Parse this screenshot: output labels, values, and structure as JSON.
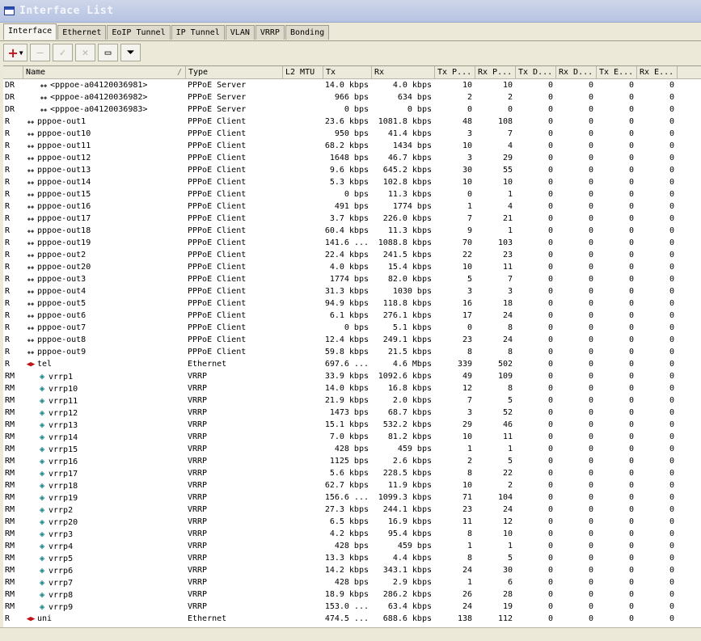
{
  "window": {
    "title": "Interface List"
  },
  "tabs": [
    "Interface",
    "Ethernet",
    "EoIP Tunnel",
    "IP Tunnel",
    "VLAN",
    "VRRP",
    "Bonding"
  ],
  "toolbar": {
    "add": "add-icon",
    "remove": "minus-icon",
    "enable": "check-icon",
    "disable": "cross-icon",
    "comment": "comment-icon",
    "filter": "filter-icon"
  },
  "columns": [
    "",
    "Name",
    "Type",
    "L2 MTU",
    "Tx",
    "Rx",
    "Tx P...",
    "Rx P...",
    "Tx D...",
    "Rx D...",
    "Tx E...",
    "Rx E..."
  ],
  "rows": [
    [
      "DR",
      "<pppoe-a04120036981>",
      "PPPoE Server",
      "",
      "14.0 kbps",
      "4.0 kbps",
      "10",
      "10",
      "0",
      "0",
      "0",
      "0"
    ],
    [
      "DR",
      "<pppoe-a04120036982>",
      "PPPoE Server",
      "",
      "966 bps",
      "634 bps",
      "2",
      "2",
      "0",
      "0",
      "0",
      "0"
    ],
    [
      "DR",
      "<pppoe-a04120036983>",
      "PPPoE Server",
      "",
      "0 bps",
      "0 bps",
      "0",
      "0",
      "0",
      "0",
      "0",
      "0"
    ],
    [
      "R",
      "pppoe-out1",
      "PPPoE Client",
      "",
      "23.6 kbps",
      "1081.8 kbps",
      "48",
      "108",
      "0",
      "0",
      "0",
      "0"
    ],
    [
      "R",
      "pppoe-out10",
      "PPPoE Client",
      "",
      "950 bps",
      "41.4 kbps",
      "3",
      "7",
      "0",
      "0",
      "0",
      "0"
    ],
    [
      "R",
      "pppoe-out11",
      "PPPoE Client",
      "",
      "68.2 kbps",
      "1434 bps",
      "10",
      "4",
      "0",
      "0",
      "0",
      "0"
    ],
    [
      "R",
      "pppoe-out12",
      "PPPoE Client",
      "",
      "1648 bps",
      "46.7 kbps",
      "3",
      "29",
      "0",
      "0",
      "0",
      "0"
    ],
    [
      "R",
      "pppoe-out13",
      "PPPoE Client",
      "",
      "9.6 kbps",
      "645.2 kbps",
      "30",
      "55",
      "0",
      "0",
      "0",
      "0"
    ],
    [
      "R",
      "pppoe-out14",
      "PPPoE Client",
      "",
      "5.3 kbps",
      "102.8 kbps",
      "10",
      "10",
      "0",
      "0",
      "0",
      "0"
    ],
    [
      "R",
      "pppoe-out15",
      "PPPoE Client",
      "",
      "0 bps",
      "11.3 kbps",
      "0",
      "1",
      "0",
      "0",
      "0",
      "0"
    ],
    [
      "R",
      "pppoe-out16",
      "PPPoE Client",
      "",
      "491 bps",
      "1774 bps",
      "1",
      "4",
      "0",
      "0",
      "0",
      "0"
    ],
    [
      "R",
      "pppoe-out17",
      "PPPoE Client",
      "",
      "3.7 kbps",
      "226.0 kbps",
      "7",
      "21",
      "0",
      "0",
      "0",
      "0"
    ],
    [
      "R",
      "pppoe-out18",
      "PPPoE Client",
      "",
      "60.4 kbps",
      "11.3 kbps",
      "9",
      "1",
      "0",
      "0",
      "0",
      "0"
    ],
    [
      "R",
      "pppoe-out19",
      "PPPoE Client",
      "",
      "141.6 ...",
      "1088.8 kbps",
      "70",
      "103",
      "0",
      "0",
      "0",
      "0"
    ],
    [
      "R",
      "pppoe-out2",
      "PPPoE Client",
      "",
      "22.4 kbps",
      "241.5 kbps",
      "22",
      "23",
      "0",
      "0",
      "0",
      "0"
    ],
    [
      "R",
      "pppoe-out20",
      "PPPoE Client",
      "",
      "4.0 kbps",
      "15.4 kbps",
      "10",
      "11",
      "0",
      "0",
      "0",
      "0"
    ],
    [
      "R",
      "pppoe-out3",
      "PPPoE Client",
      "",
      "1774 bps",
      "82.0 kbps",
      "5",
      "7",
      "0",
      "0",
      "0",
      "0"
    ],
    [
      "R",
      "pppoe-out4",
      "PPPoE Client",
      "",
      "31.3 kbps",
      "1030 bps",
      "3",
      "3",
      "0",
      "0",
      "0",
      "0"
    ],
    [
      "R",
      "pppoe-out5",
      "PPPoE Client",
      "",
      "94.9 kbps",
      "118.8 kbps",
      "16",
      "18",
      "0",
      "0",
      "0",
      "0"
    ],
    [
      "R",
      "pppoe-out6",
      "PPPoE Client",
      "",
      "6.1 kbps",
      "276.1 kbps",
      "17",
      "24",
      "0",
      "0",
      "0",
      "0"
    ],
    [
      "R",
      "pppoe-out7",
      "PPPoE Client",
      "",
      "0 bps",
      "5.1 kbps",
      "0",
      "8",
      "0",
      "0",
      "0",
      "0"
    ],
    [
      "R",
      "pppoe-out8",
      "PPPoE Client",
      "",
      "12.4 kbps",
      "249.1 kbps",
      "23",
      "24",
      "0",
      "0",
      "0",
      "0"
    ],
    [
      "R",
      "pppoe-out9",
      "PPPoE Client",
      "",
      "59.8 kbps",
      "21.5 kbps",
      "8",
      "8",
      "0",
      "0",
      "0",
      "0"
    ],
    [
      "R",
      "tel",
      "Ethernet",
      "",
      "697.6 ...",
      "4.6 Mbps",
      "339",
      "502",
      "0",
      "0",
      "0",
      "0"
    ],
    [
      "RM",
      "vrrp1",
      "VRRP",
      "",
      "33.9 kbps",
      "1092.6 kbps",
      "49",
      "109",
      "0",
      "0",
      "0",
      "0"
    ],
    [
      "RM",
      "vrrp10",
      "VRRP",
      "",
      "14.0 kbps",
      "16.8 kbps",
      "12",
      "8",
      "0",
      "0",
      "0",
      "0"
    ],
    [
      "RM",
      "vrrp11",
      "VRRP",
      "",
      "21.9 kbps",
      "2.0 kbps",
      "7",
      "5",
      "0",
      "0",
      "0",
      "0"
    ],
    [
      "RM",
      "vrrp12",
      "VRRP",
      "",
      "1473 bps",
      "68.7 kbps",
      "3",
      "52",
      "0",
      "0",
      "0",
      "0"
    ],
    [
      "RM",
      "vrrp13",
      "VRRP",
      "",
      "15.1 kbps",
      "532.2 kbps",
      "29",
      "46",
      "0",
      "0",
      "0",
      "0"
    ],
    [
      "RM",
      "vrrp14",
      "VRRP",
      "",
      "7.0 kbps",
      "81.2 kbps",
      "10",
      "11",
      "0",
      "0",
      "0",
      "0"
    ],
    [
      "RM",
      "vrrp15",
      "VRRP",
      "",
      "428 bps",
      "459 bps",
      "1",
      "1",
      "0",
      "0",
      "0",
      "0"
    ],
    [
      "RM",
      "vrrp16",
      "VRRP",
      "",
      "1125 bps",
      "2.6 kbps",
      "2",
      "5",
      "0",
      "0",
      "0",
      "0"
    ],
    [
      "RM",
      "vrrp17",
      "VRRP",
      "",
      "5.6 kbps",
      "228.5 kbps",
      "8",
      "22",
      "0",
      "0",
      "0",
      "0"
    ],
    [
      "RM",
      "vrrp18",
      "VRRP",
      "",
      "62.7 kbps",
      "11.9 kbps",
      "10",
      "2",
      "0",
      "0",
      "0",
      "0"
    ],
    [
      "RM",
      "vrrp19",
      "VRRP",
      "",
      "156.6 ...",
      "1099.3 kbps",
      "71",
      "104",
      "0",
      "0",
      "0",
      "0"
    ],
    [
      "RM",
      "vrrp2",
      "VRRP",
      "",
      "27.3 kbps",
      "244.1 kbps",
      "23",
      "24",
      "0",
      "0",
      "0",
      "0"
    ],
    [
      "RM",
      "vrrp20",
      "VRRP",
      "",
      "6.5 kbps",
      "16.9 kbps",
      "11",
      "12",
      "0",
      "0",
      "0",
      "0"
    ],
    [
      "RM",
      "vrrp3",
      "VRRP",
      "",
      "4.2 kbps",
      "95.4 kbps",
      "8",
      "10",
      "0",
      "0",
      "0",
      "0"
    ],
    [
      "RM",
      "vrrp4",
      "VRRP",
      "",
      "428 bps",
      "459 bps",
      "1",
      "1",
      "0",
      "0",
      "0",
      "0"
    ],
    [
      "RM",
      "vrrp5",
      "VRRP",
      "",
      "13.3 kbps",
      "4.4 kbps",
      "8",
      "5",
      "0",
      "0",
      "0",
      "0"
    ],
    [
      "RM",
      "vrrp6",
      "VRRP",
      "",
      "14.2 kbps",
      "343.1 kbps",
      "24",
      "30",
      "0",
      "0",
      "0",
      "0"
    ],
    [
      "RM",
      "vrrp7",
      "VRRP",
      "",
      "428 bps",
      "2.9 kbps",
      "1",
      "6",
      "0",
      "0",
      "0",
      "0"
    ],
    [
      "RM",
      "vrrp8",
      "VRRP",
      "",
      "18.9 kbps",
      "286.2 kbps",
      "26",
      "28",
      "0",
      "0",
      "0",
      "0"
    ],
    [
      "RM",
      "vrrp9",
      "VRRP",
      "",
      "153.0 ...",
      "63.4 kbps",
      "24",
      "19",
      "0",
      "0",
      "0",
      "0"
    ],
    [
      "R",
      "uni",
      "Ethernet",
      "",
      "474.5 ...",
      "688.6 kbps",
      "138",
      "112",
      "0",
      "0",
      "0",
      "0"
    ]
  ]
}
